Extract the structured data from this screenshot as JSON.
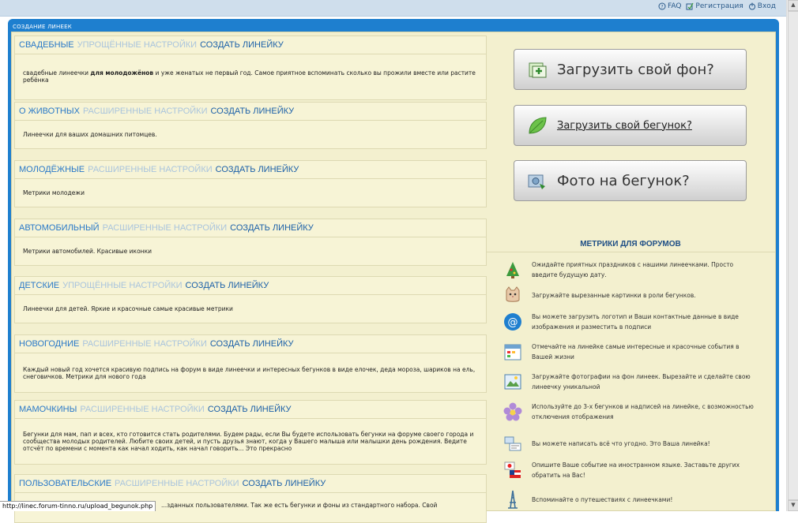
{
  "header": {
    "links": [
      {
        "label": "FAQ",
        "icon": "help-icon"
      },
      {
        "label": "Регистрация",
        "icon": "register-icon"
      },
      {
        "label": "Вход",
        "icon": "login-icon"
      }
    ]
  },
  "frame": {
    "title": "СОЗДАНИЕ ЛИНЕЕК"
  },
  "categories": [
    {
      "name": "Свадебные",
      "settings": "Упрощённые настройки",
      "create": "Создать линейку",
      "desc_pre": "свадебные линеечки ",
      "desc_bold": "для молодожёнов",
      "desc_post": " и уже женатых не первый год. Самое приятное вспоминать сколько вы прожили вместе или растите ребёнка"
    },
    {
      "name": "О животных",
      "settings": "Расширенные настройки",
      "create": "Создать линейку",
      "desc_pre": "Линеечки для ваших домашних питомцев.",
      "desc_bold": "",
      "desc_post": ""
    },
    {
      "name": "Молодёжные",
      "settings": "Расширенные настройки",
      "create": "Создать линейку",
      "desc_pre": "Метрики молодежи",
      "desc_bold": "",
      "desc_post": ""
    },
    {
      "name": "Автомобильный",
      "settings": "Расширенные настройки",
      "create": "Создать линейку",
      "desc_pre": "Метрики автомобилей. Красивые иконки",
      "desc_bold": "",
      "desc_post": ""
    },
    {
      "name": "Детские",
      "settings": "Упрощённые настройки",
      "create": "Создать линейку",
      "desc_pre": "Линеечки для детей. Яркие и красочные самые красивые метрики",
      "desc_bold": "",
      "desc_post": ""
    },
    {
      "name": "Новогодние",
      "settings": "Расширенные настройки",
      "create": "Создать линейку",
      "desc_pre": "Каждый новый год хочется красивую подпись на форум в виде линеечки и интересных бегунков в виде елочек, деда мороза, шариков на ель, снеговичков. Метрики для нового года",
      "desc_bold": "",
      "desc_post": ""
    },
    {
      "name": "Мамочкины",
      "settings": "Расширенные настройки",
      "create": "Создать линейку",
      "desc_pre": "Бегунки для мам, пап и всех, кто готовится стать родителями. Будем рады, если Вы будете использовать бегунки на форуме своего города и сообщества молодых родителей. Любите своих детей, и пусть друзья знают, когда у Вашего малыша или малышки день рождения. Ведите отсчёт по времени с момента как начал ходить, как начал говорить... Это прекрасно",
      "desc_bold": "",
      "desc_post": ""
    },
    {
      "name": "Пользовательские",
      "settings": "Расширенные настройки",
      "create": "Создать линейку",
      "desc_pre": "...зданных пользователями. Так же есть бегунки и фоны из стандартного набора. Свой",
      "desc_bold": "",
      "desc_post": ""
    }
  ],
  "buttons": [
    {
      "label": "Загрузить свой фон?",
      "icon": "upload-background-icon"
    },
    {
      "label": "Загрузить свой бегунок?",
      "icon": "leaf-icon"
    },
    {
      "label": "Фото на бегунок?",
      "icon": "photo-icon"
    }
  ],
  "forum": {
    "title": "МЕТРИКИ ДЛЯ ФОРУМОВ",
    "features": [
      {
        "icon": "christmas-tree-icon",
        "text": "Ожидайте приятных праздников с нашими линеечками. Просто введите будущую дату."
      },
      {
        "icon": "cat-icon",
        "text": "Загружайте вырезанные картинки в роли бегунков."
      },
      {
        "icon": "at-icon",
        "text": "Вы можете загрузить логотип и Ваши контактные данные в виде изображения и разместить в подписи"
      },
      {
        "icon": "calendar-icon",
        "text": "Отмечайте на линейке самые интересные и красочные события в Вашей жизни"
      },
      {
        "icon": "picture-icon",
        "text": "Загружайте фотографии на фон линеек. Вырезайте и сделайте свою линеечку уникальной"
      },
      {
        "icon": "flower-icon",
        "text": "Используйте до 3-х бегунков и надписей на линейке, с возможностью отключения отображения"
      },
      {
        "icon": "text-icon",
        "text": "Вы можете написать всё что угодно. Это Ваша линейка!"
      },
      {
        "icon": "flags-icon",
        "text": "Опишите Ваше событие на иностранном языке. Заставьте других обратить на Вас!"
      },
      {
        "icon": "eiffel-tower-icon",
        "text": "Вспоминайте о путешествиях с линеечками!"
      }
    ]
  },
  "status": {
    "url": "http://linec.forum-tinno.ru/upload_begunok.php"
  }
}
